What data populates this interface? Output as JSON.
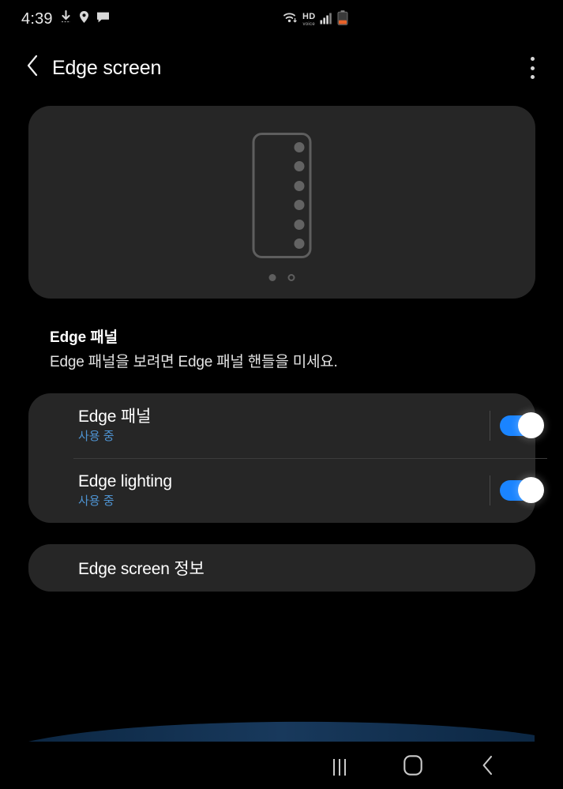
{
  "status_bar": {
    "time": "4:39",
    "left_icons": [
      "download-icon",
      "location-pin-icon",
      "message-bubble-icon"
    ],
    "right_icons": [
      "wifi-icon",
      "hd-voice-icon",
      "signal-bars-icon",
      "battery-low-icon"
    ],
    "hd_label": "HD",
    "voice_label": "voice"
  },
  "header": {
    "back_icon": "chevron-left-icon",
    "title": "Edge screen",
    "more_icon": "more-vertical-icon"
  },
  "preview": {
    "edge_handle_dot_count": 6,
    "page_indicators": [
      {
        "state": "filled"
      },
      {
        "state": "hollow"
      }
    ]
  },
  "section": {
    "title": "Edge 패널",
    "description": "Edge 패널을 보려면 Edge 패널 핸들을 미세요."
  },
  "settings": {
    "rows": [
      {
        "title": "Edge 패널",
        "subtitle": "사용 중",
        "toggle_state": "on"
      },
      {
        "title": "Edge lighting",
        "subtitle": "사용 중",
        "toggle_state": "on"
      }
    ]
  },
  "info_row": {
    "label": "Edge screen 정보"
  },
  "nav_bar": {
    "recents_icon": "recents-icon",
    "home_icon": "home-icon",
    "back_icon": "back-chevron-icon"
  },
  "colors": {
    "background": "#000000",
    "card": "#262626",
    "accent_blue": "#1a84ff",
    "subtitle_blue": "#4e93d1",
    "text_primary": "#ffffff",
    "edge_glow": "#15304f"
  }
}
